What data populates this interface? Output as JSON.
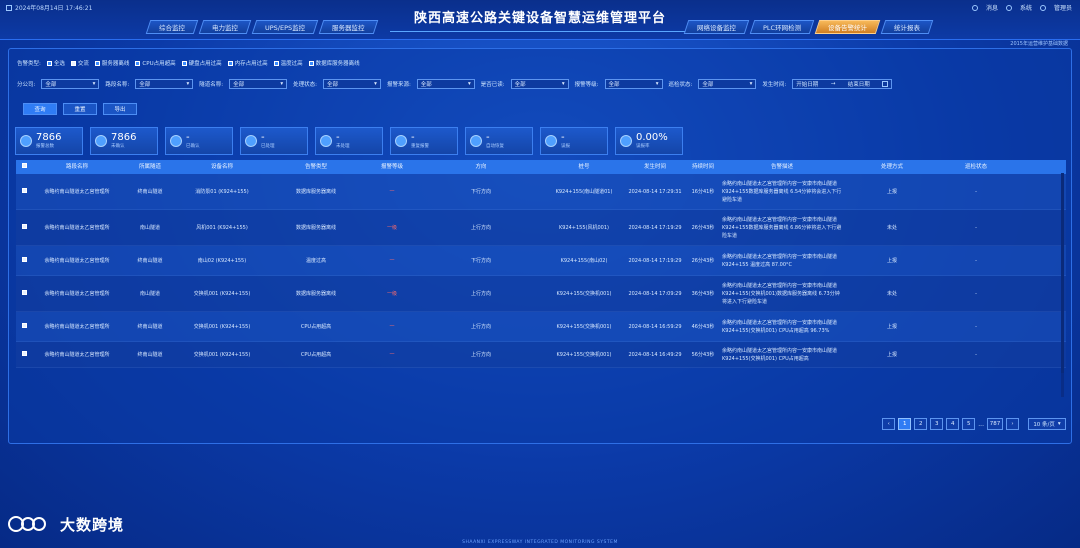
{
  "header": {
    "datetime": "2024年08月14日 17:46:21",
    "title": "陕西高速公路关键设备智慧运维管理平台",
    "nav_left": [
      "综合监控",
      "电力监控",
      "UPS/EPS监控",
      "服务器监控"
    ],
    "nav_right": [
      "网络设备监控",
      "PLC环网检测",
      "设备告警统计",
      "统计报表"
    ],
    "active_nav": "设备告警统计",
    "user": [
      "消息",
      "系统",
      "管理员"
    ],
    "note": "2015年运营维护基础数据"
  },
  "filters": {
    "alarm_type_label": "告警类型:",
    "types": [
      {
        "label": "全选",
        "on": true
      },
      {
        "label": "交流",
        "on": false
      },
      {
        "label": "服务器离线",
        "on": true
      },
      {
        "label": "CPU占用超高",
        "on": true
      },
      {
        "label": "硬盘占用过高",
        "on": true
      },
      {
        "label": "内存占用过高",
        "on": true
      },
      {
        "label": "温度过高",
        "on": true
      },
      {
        "label": "数据库服务器离线",
        "on": true
      }
    ],
    "selects": [
      {
        "label": "分公司:",
        "value": "全部"
      },
      {
        "label": "路段名称:",
        "value": "全部"
      },
      {
        "label": "隧道名称:",
        "value": "全部"
      },
      {
        "label": "处理状态:",
        "value": "全部"
      },
      {
        "label": "报警来源:",
        "value": "全部"
      },
      {
        "label": "是否已读:",
        "value": "全部"
      },
      {
        "label": "报警等级:",
        "value": "全部"
      },
      {
        "label": "巡检状态:",
        "value": "全部"
      }
    ],
    "time_label": "发生时间:",
    "start_placeholder": "开始日期",
    "end_placeholder": "结束日期",
    "arrow": "→"
  },
  "actions": [
    "查询",
    "重置",
    "导出"
  ],
  "stats": [
    {
      "value": "7866",
      "label": "报警总数"
    },
    {
      "value": "7866",
      "label": "未确认"
    },
    {
      "value": "-",
      "label": "已确认"
    },
    {
      "value": "-",
      "label": "已处理"
    },
    {
      "value": "-",
      "label": "未处理"
    },
    {
      "value": "-",
      "label": "重复报警"
    },
    {
      "value": "-",
      "label": "自动恢复"
    },
    {
      "value": "-",
      "label": "误报"
    },
    {
      "value": "0.00%",
      "label": "误报率"
    }
  ],
  "table": {
    "headers": [
      "路段名称",
      "所属隧道",
      "设备名称",
      "告警类型",
      "报警等级",
      "方向",
      "桩号",
      "发生时间",
      "持续时间",
      "告警描述",
      "处理方式",
      "巡检状态"
    ],
    "rows": [
      [
        "余略约南山隧道太乙宫管理所",
        "终南山隧道",
        "消防泵01 (K924+155)",
        "数据库服务器离线",
        "一",
        "下行方向",
        "K924+155(南山隧道01)",
        "2024-08-14 17:29:31",
        "16分41秒",
        "余略约南山隧道太乙宫管理所内容一安康市南山隧道K924+155数据库服务器离线 6.54分钟将会进入下行避险车道",
        "上报",
        "-"
      ],
      [
        "余略约南山隧道太乙宫管理所",
        "南山隧道",
        "风机001 (K924+155)",
        "数据库服务器离线",
        "一级",
        "上行方向",
        "K924+155(风机001)",
        "2024-08-14 17:19:29",
        "26分43秒",
        "余略约南山隧道太乙宫管理所内容一安康市南山隧道K924+155数据库服务器离线 6.86分钟将进入下行避险车道",
        "未处",
        "-"
      ],
      [
        "余略约南山隧道太乙宫管理所",
        "终南山隧道",
        "南山02 (K924+155)",
        "温度过高",
        "一",
        "下行方向",
        "K924+155(南山02)",
        "2024-08-14 17:19:29",
        "26分43秒",
        "余略约南山隧道太乙宫管理所内容一安康市南山隧道 K924+155 温度过高 87.00°C",
        "上报",
        "-"
      ],
      [
        "余略约南山隧道太乙宫管理所",
        "南山隧道",
        "交换机001 (K924+155)",
        "数据库服务器离线",
        "一级",
        "上行方向",
        "K924+155(交换机001)",
        "2024-08-14 17:09:29",
        "36分43秒",
        "余略约南山隧道太乙宫管理所内容一安康市南山隧道K924+155(交换机001)数据库服务器离线 6.73分钟将进入下行避险车道",
        "未处",
        "-"
      ],
      [
        "余略约南山隧道太乙宫管理所",
        "终南山隧道",
        "交换机001 (K924+155)",
        "CPU占用超高",
        "一",
        "上行方向",
        "K924+155(交换机001)",
        "2024-08-14 16:59:29",
        "46分43秒",
        "余略约南山隧道太乙宫管理所内容一安康市南山隧道K924+155(交换机001) CPU占用超高 96.73%",
        "上报",
        "-"
      ],
      [
        "余略约南山隧道太乙宫管理所",
        "终南山隧道",
        "交换机001 (K924+155)",
        "CPU占用超高",
        "一",
        "上行方向",
        "K924+155(交换机001)",
        "2024-08-14 16:49:29",
        "56分43秒",
        "余略约南山隧道太乙宫管理所内容一安康市南山隧道K924+155(交换机001) CPU占用超高",
        "上报",
        "-"
      ]
    ]
  },
  "pager": {
    "prev": "‹",
    "pages": [
      "1",
      "2",
      "3",
      "4",
      "5"
    ],
    "ellipsis": "...",
    "last": "787",
    "next": "›",
    "size": "10 条/页"
  },
  "footer": "SHAANXI EXPRESSWAY INTEGRATED MONITORING SYSTEM",
  "watermark": {
    "logo": "ICO",
    "text": "大数跨境"
  }
}
